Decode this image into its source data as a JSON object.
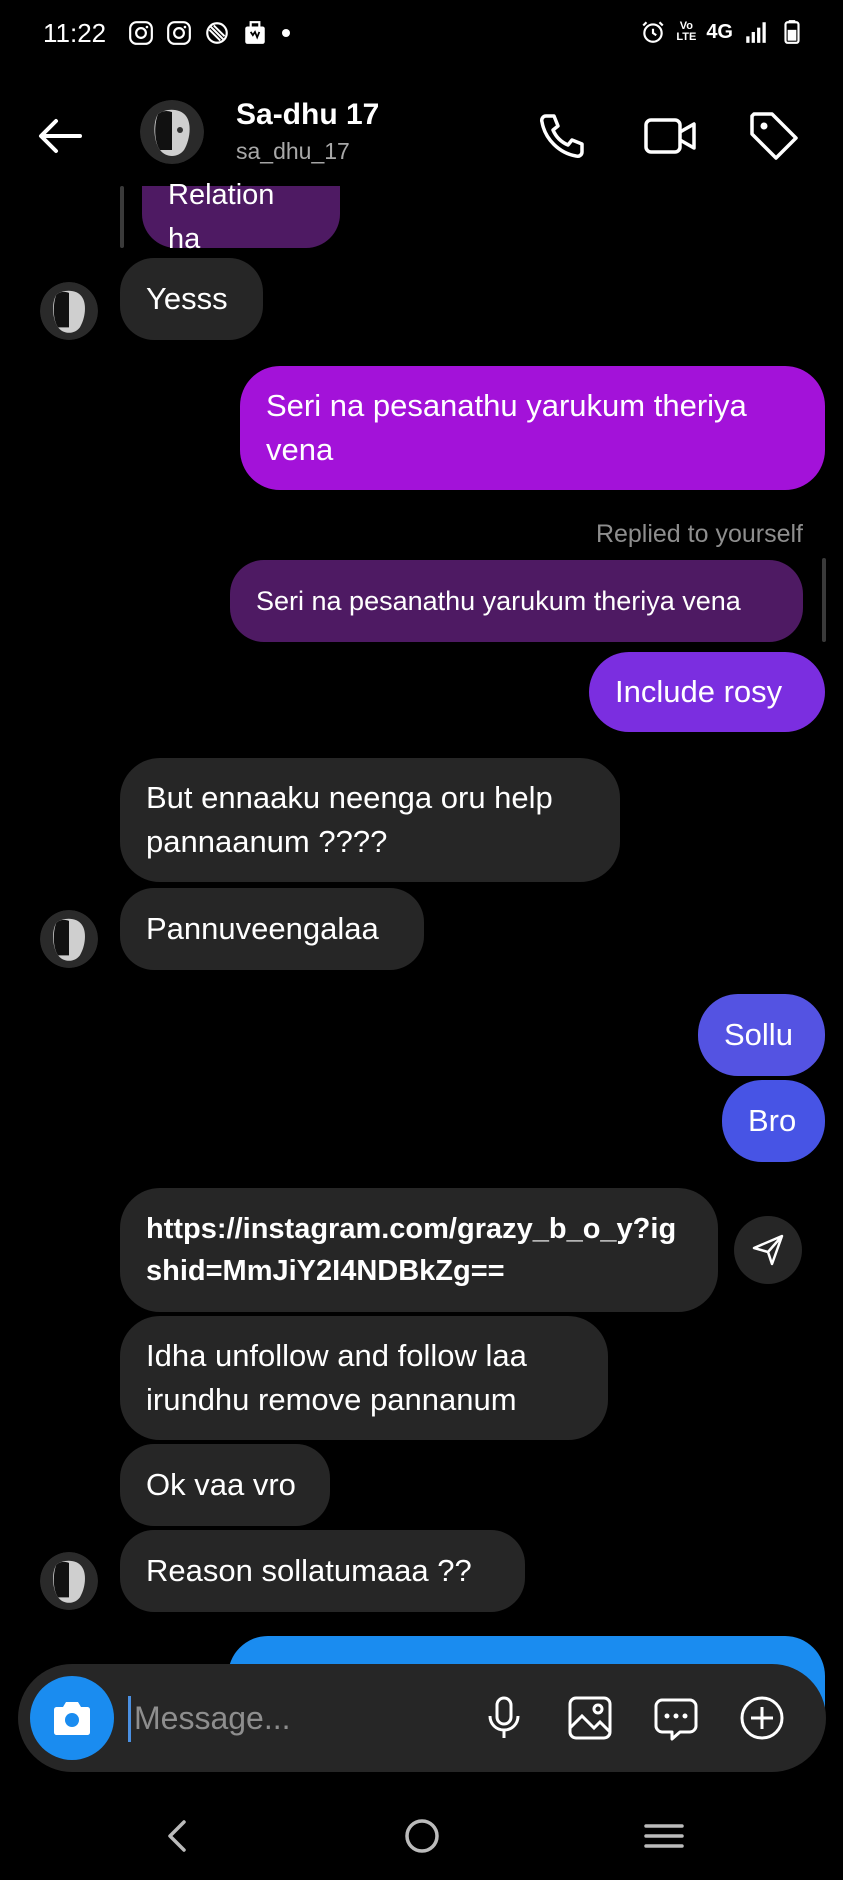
{
  "status": {
    "time": "11:22",
    "network": "4G",
    "volte": "Vo LTE"
  },
  "header": {
    "name": "Sa-dhu 17",
    "handle": "sa_dhu_17"
  },
  "messages": {
    "m1": "Relation ha",
    "m2": "Yesss",
    "m3": "Seri na pesanathu yarukum theriya vena",
    "replied_label": "Replied to yourself",
    "m4": "Seri na pesanathu yarukum theriya vena",
    "m5": "Include rosy",
    "m6": "But ennaaku neenga oru help pannaanum ????",
    "m7": "Pannuveengalaa",
    "m8": "Sollu",
    "m9": "Bro",
    "m10": "https://instagram.com/grazy_b_o_y?igshid=MmJiY2I4NDBkZg==",
    "m11": "Idha unfollow and follow laa irundhu remove pannanum",
    "m12": "Ok vaa vro",
    "m13": "Reason sollatumaaa ??"
  },
  "composer": {
    "placeholder": "Message..."
  },
  "colors": {
    "outgoing_gradient_top": "#a312d9",
    "outgoing_mid": "#7b2ee0",
    "outgoing_bottom": "#4754e5",
    "outgoing_latest": "#1a8cf0",
    "incoming": "#262626",
    "reply_quote": "#4e1a63",
    "camera_button": "#1a8cf0"
  },
  "icons": [
    "instagram-icon",
    "instagram-icon",
    "shield-slash-icon",
    "gift-icon",
    "alarm-icon",
    "signal-icon",
    "battery-icon",
    "back-arrow-icon",
    "phone-icon",
    "video-camera-icon",
    "tag-icon",
    "share-icon",
    "camera-icon",
    "microphone-icon",
    "gallery-icon",
    "sticker-icon",
    "plus-icon",
    "nav-back-icon",
    "nav-home-icon",
    "nav-recents-icon"
  ]
}
